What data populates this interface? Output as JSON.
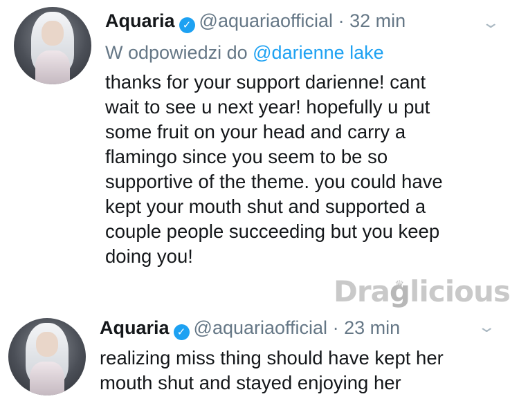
{
  "tweets": [
    {
      "name": "Aquaria",
      "handle": "@aquariaofficial",
      "separator": "·",
      "time": "32 min",
      "reply_prefix": "W odpowiedzi do",
      "reply_to": "@darienne lake",
      "text": "thanks for your support darienne! cant\nwait to see u next year! hopefully u put\nsome fruit on your head and carry a\nflamingo since you seem to be so\nsupportive of the theme. you could have\nkept your mouth shut and supported a\ncouple people succeeding but you keep\ndoing you!"
    },
    {
      "name": "Aquaria",
      "handle": "@aquariaofficial",
      "separator": "·",
      "time": "23 min",
      "text": "realizing miss thing should have kept her\nmouth shut and stayed enjoying her"
    }
  ],
  "icons": {
    "verified": "verified-check-icon",
    "caret": "chevron-down-icon"
  },
  "watermark": "DragGlicious",
  "colors": {
    "accent": "#1da1f2",
    "secondary_text": "#657786",
    "primary_text": "#14171a"
  }
}
